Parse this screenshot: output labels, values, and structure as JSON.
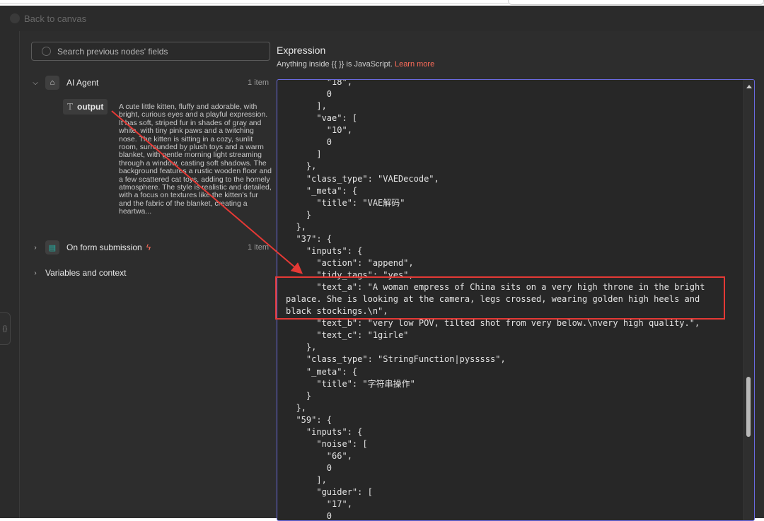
{
  "back_link": "Back to canvas",
  "search": {
    "placeholder": "Search previous nodes' fields"
  },
  "nodes": [
    {
      "label": "AI Agent",
      "count": "1 item",
      "expanded": true,
      "icon": "robot-icon",
      "field": {
        "name": "output",
        "type_icon": "T",
        "value": "A cute little kitten, fluffy and adorable, with bright, curious eyes and a playful expression. It has soft, striped fur in shades of gray and white, with tiny pink paws and a twitching nose. The kitten is sitting in a cozy, sunlit room, surrounded by plush toys and a warm blanket, with gentle morning light streaming through a window, casting soft shadows. The background features a rustic wooden floor and a few scattered cat toys, adding to the homely atmosphere. The style is realistic and detailed, with a focus on textures like the kitten's fur and the fabric of the blanket, creating a heartwa..."
      }
    },
    {
      "label": "On form submission",
      "count": "1 item",
      "expanded": false,
      "icon": "form-icon"
    }
  ],
  "variables_label": "Variables and context",
  "expression": {
    "title": "Expression",
    "subtitle_prefix": "Anything inside {{ }} is JavaScript.",
    "learn_more": "Learn more",
    "code": "        \"18\",\n        0\n      ],\n      \"vae\": [\n        \"10\",\n        0\n      ]\n    },\n    \"class_type\": \"VAEDecode\",\n    \"_meta\": {\n      \"title\": \"VAE解码\"\n    }\n  },\n  \"37\": {\n    \"inputs\": {\n      \"action\": \"append\",\n      \"tidy_tags\": \"yes\",\n      \"text_a\": \"A woman empress of China sits on a very high throne in the bright palace. She is looking at the camera, legs crossed, wearing golden high heels and black stockings.\\n\",\n      \"text_b\": \"very low POV, tilted shot from very below.\\nvery high quality.\",\n      \"text_c\": \"1girle\"\n    },\n    \"class_type\": \"StringFunction|pysssss\",\n    \"_meta\": {\n      \"title\": \"字符串操作\"\n    }\n  },\n  \"59\": {\n    \"inputs\": {\n      \"noise\": [\n        \"66\",\n        0\n      ],\n      \"guider\": [\n        \"17\",\n        0"
  },
  "colors": {
    "accent": "#ff6d5a",
    "annotation": "#e53935",
    "editor_border": "#6a6ae0"
  }
}
